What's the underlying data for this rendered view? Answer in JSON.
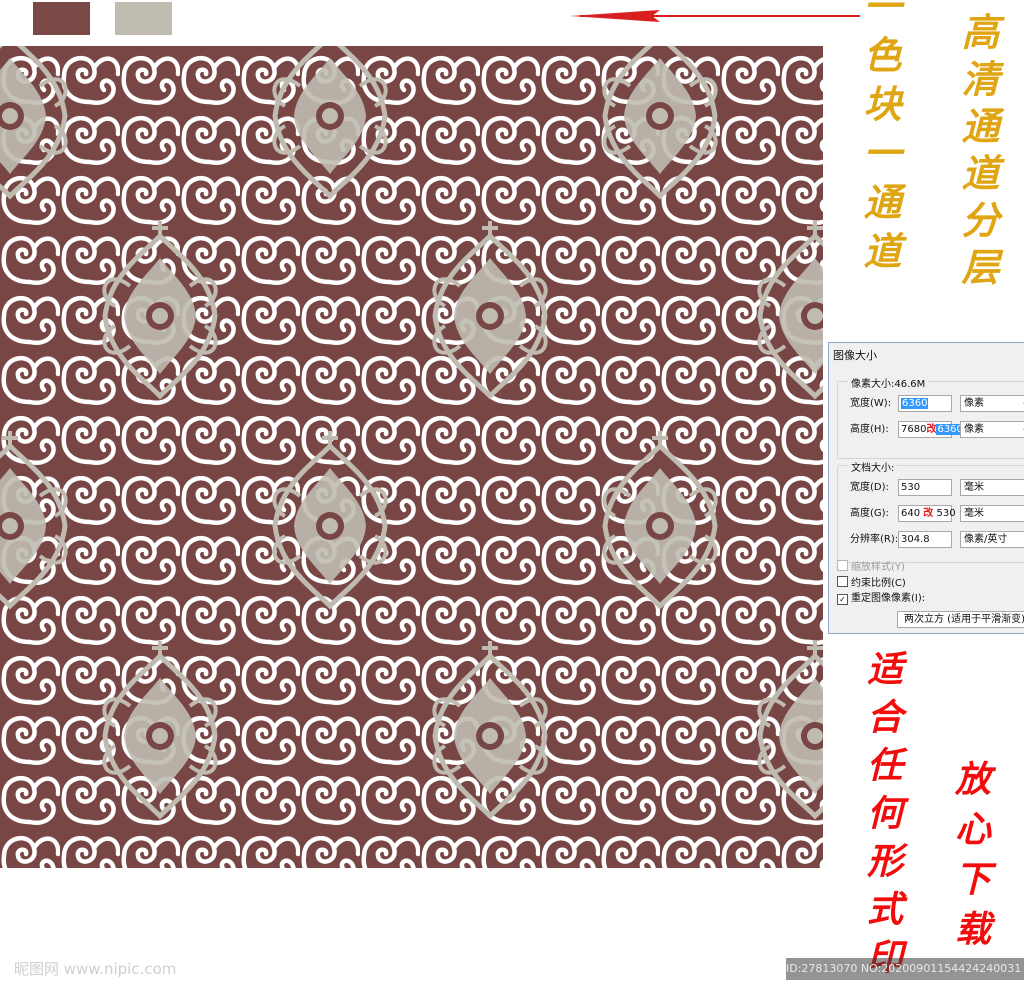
{
  "swatches": {
    "primary": "#7b4a48",
    "secondary": "#c0bcb1"
  },
  "pattern": {
    "background": "#784645",
    "scroll_color": "#ffffff",
    "damask_color": "#bfbbb0"
  },
  "captions": {
    "channel": "一色块一通道",
    "hd": "高清通道分层",
    "print": "适合任何形式印",
    "download": "放心下载"
  },
  "dialog": {
    "title": "图像大小",
    "pixel_size_label": "像素大小:46.6M",
    "pixel_width_label": "宽度(W):",
    "pixel_width_value": "6360",
    "pixel_width_unit": "像素",
    "pixel_height_label": "高度(H):",
    "pixel_height_old": "7680",
    "pixel_height_value": "6360",
    "pixel_height_unit": "像素",
    "doc_size_label": "文档大小:",
    "doc_width_label": "宽度(D):",
    "doc_width_value": "530",
    "doc_width_unit": "毫米",
    "doc_height_label": "高度(G):",
    "doc_height_old": "640",
    "doc_height_value": "530",
    "doc_height_unit": "毫米",
    "resolution_label": "分辨率(R):",
    "resolution_value": "304.8",
    "resolution_unit": "像素/英寸",
    "scale_styles_label": "缩放样式(Y)",
    "constrain_label": "约束比例(C)",
    "resample_label": "重定图像像素(I):",
    "resample_method": "两次立方 (适用于平滑渐变)",
    "change_mark": "改"
  },
  "watermark": {
    "left": "昵图网 www.nipic.com",
    "right": "ID:27813070 NO:20200901154424240031"
  }
}
